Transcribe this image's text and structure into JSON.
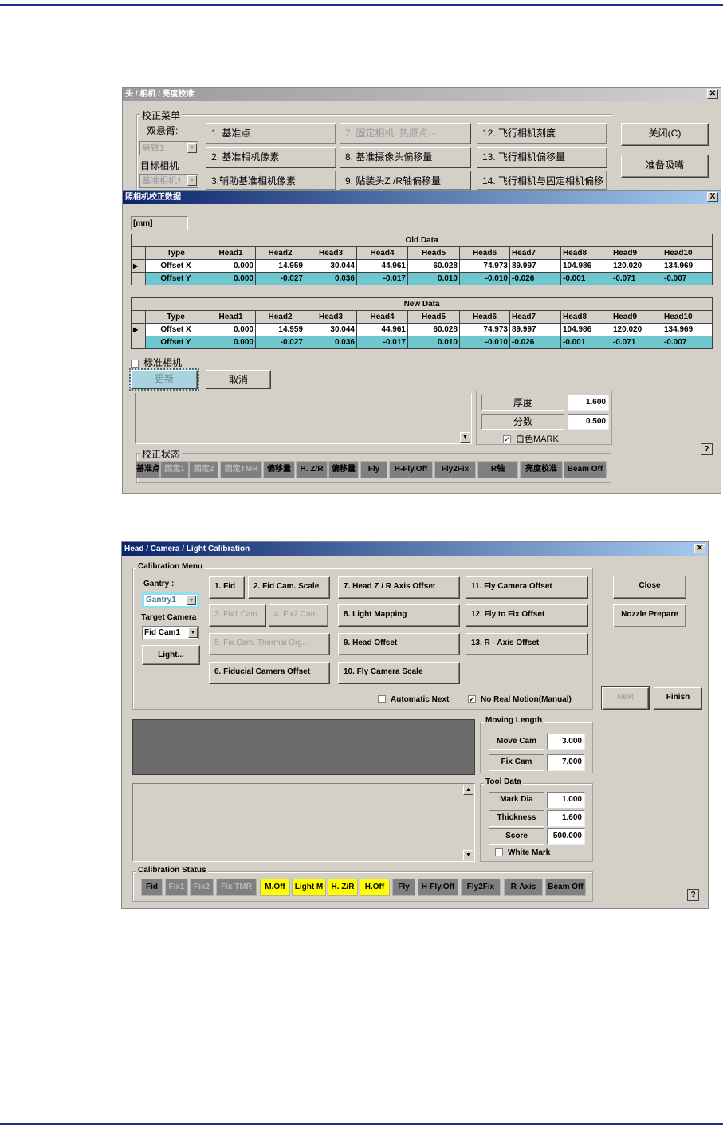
{
  "cn_dialog": {
    "title": "头 / 相机 / 亮度校准",
    "menu_group": "校正菜单",
    "gantry_label": "双悬臂:",
    "gantry_value": "悬臂1",
    "target_label": "目标相机",
    "target_value": "基准相机1",
    "buttons": [
      "1. 基准点",
      "7. 固定相机. 热原点···",
      "12. 飞行相机刻度",
      "2. 基准相机像素",
      "8. 基准摄像头偏移量",
      "13. 飞行相机偏移量",
      "3.辅助基准相机像素",
      "9. 贴装头Z /R轴偏移量",
      "14. 飞行相机与固定相机偏移"
    ],
    "close_label": "关闭(C)",
    "nozzle_label": "准备吸嘴",
    "thickness_label": "厚度",
    "thickness_value": "1.600",
    "score_label": "分数",
    "score_value": "0.500",
    "white_mark_label": "白色MARK",
    "status_group": "校正状态",
    "status": [
      "基准点",
      "固定1",
      "固定2",
      "固定TMR",
      "偏移量",
      "H. Z/R",
      "偏移量",
      "Fly",
      "H-Fly.Off",
      "Fly2Fix",
      "R轴",
      "亮度校准",
      "Beam Off"
    ],
    "help": "?"
  },
  "cn_data_dialog": {
    "title": "照相机校正数据",
    "unit": "[mm]",
    "columns": [
      "Type",
      "Head1",
      "Head2",
      "Head3",
      "Head4",
      "Head5",
      "Head6",
      "Head7",
      "Head8",
      "Head9",
      "Head10"
    ],
    "old_caption": "Old Data",
    "new_caption": "New Data",
    "old_rows": [
      [
        "Offset X",
        "0.000",
        "14.959",
        "30.044",
        "44.961",
        "60.028",
        "74.973",
        "89.997",
        "104.986",
        "120.020",
        "134.969"
      ],
      [
        "Offset Y",
        "0.000",
        "-0.027",
        "0.036",
        "-0.017",
        "0.010",
        "-0.010",
        "-0.026",
        "-0.001",
        "-0.071",
        "-0.007"
      ]
    ],
    "new_rows": [
      [
        "Offset X",
        "0.000",
        "14.959",
        "30.044",
        "44.961",
        "60.028",
        "74.973",
        "89.997",
        "104.986",
        "120.020",
        "134.969"
      ],
      [
        "Offset Y",
        "0.000",
        "-0.027",
        "0.036",
        "-0.017",
        "0.010",
        "-0.010",
        "-0.026",
        "-0.001",
        "-0.071",
        "-0.007"
      ]
    ],
    "std_camera_label": "标准相机",
    "update_label": "更新",
    "cancel_label": "取消",
    "close_icon": "X"
  },
  "en_dialog": {
    "title": "Head / Camera / Light Calibration",
    "menu_group": "Calibration Menu",
    "gantry_label": "Gantry :",
    "gantry_value": "Gantry1",
    "target_label": "Target Camera",
    "target_value": "Fid Cam1",
    "light_label": "Light...",
    "buttons": [
      "1. Fid",
      "2. Fid Cam. Scale",
      "7. Head Z / R Axis Offset",
      "11. Fly Camera Offset",
      "3. Fix1 Cam.",
      "4. Fix2 Cam.",
      "8. Light Mapping",
      "12. Fly to Fix Offset",
      "5. Fix Cam. Thermal Org...",
      "9. Head Offset",
      "13. R - Axis Offset",
      "6. Fiducial Camera Offset",
      "10. Fly Camera Scale"
    ],
    "close_label": "Close",
    "nozzle_label": "Nozzle Prepare",
    "automatic_next_label": "Automatic Next",
    "no_real_motion_label": "No Real Motion(Manual)",
    "next_label": "Next",
    "finish_label": "Finish",
    "moving_group": "Moving Length",
    "move_cam_label": "Move Cam",
    "move_cam_value": "3.000",
    "fix_cam_label": "Fix Cam",
    "fix_cam_value": "7.000",
    "tool_group": "Tool Data",
    "mark_dia_label": "Mark Dia",
    "mark_dia_value": "1.000",
    "thickness_label": "Thickness",
    "thickness_value": "1.600",
    "score_label": "Score",
    "score_value": "500.000",
    "white_mark_label": "White Mark",
    "status_group": "Calibration Status",
    "status": [
      "Fid",
      "Fix1",
      "Fix2",
      "Fix TMR",
      "M.Off",
      "Light M",
      "H. Z/R",
      "H.Off",
      "Fly",
      "H-Fly.Off",
      "Fly2Fix",
      "R-Axis",
      "Beam Off"
    ],
    "help": "?"
  },
  "colors": {
    "accent_rule": "#1a2f8f",
    "completed": "#ffff00",
    "grid_highlight": "#6ec7cf"
  }
}
